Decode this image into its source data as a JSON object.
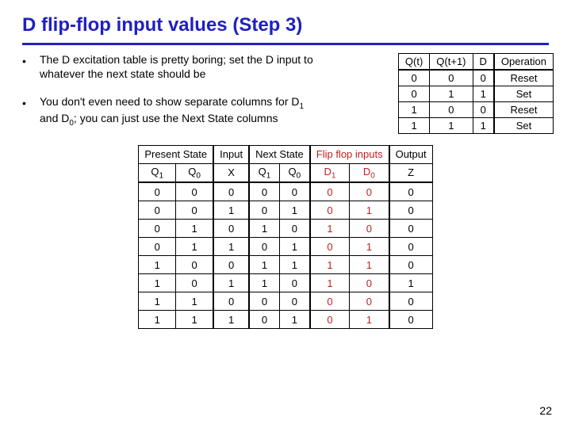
{
  "title": "D flip-flop input values (Step 3)",
  "bullets": [
    "The D excitation table is pretty boring; set the D input to whatever the next state should be",
    "You don't even need to show separate columns for D₁ and D₀; you can just use the Next State columns"
  ],
  "excitation_table": {
    "headers": [
      "Q(t)",
      "Q(t+1)",
      "D",
      "Operation"
    ],
    "rows": [
      [
        "0",
        "0",
        "0",
        "Reset"
      ],
      [
        "0",
        "1",
        "1",
        "Set"
      ],
      [
        "1",
        "0",
        "0",
        "Reset"
      ],
      [
        "1",
        "1",
        "1",
        "Set"
      ]
    ]
  },
  "main_table": {
    "group_headers": [
      {
        "label": "Present State",
        "span": 2
      },
      {
        "label": "Input",
        "span": 1
      },
      {
        "label": "Next State",
        "span": 2
      },
      {
        "label": "Flip flop inputs",
        "span": 2
      },
      {
        "label": "Output",
        "span": 1
      }
    ],
    "sub_headers": [
      "Q₁",
      "Q₀",
      "X",
      "Q₁",
      "Q₀",
      "D₁",
      "D₀",
      "Z"
    ],
    "rows": [
      [
        "0",
        "0",
        "0",
        "0",
        "0",
        "0",
        "0",
        "0"
      ],
      [
        "0",
        "0",
        "1",
        "0",
        "1",
        "0",
        "1",
        "0"
      ],
      [
        "0",
        "1",
        "0",
        "1",
        "0",
        "1",
        "0",
        "0"
      ],
      [
        "0",
        "1",
        "1",
        "0",
        "1",
        "0",
        "1",
        "0"
      ],
      [
        "1",
        "0",
        "0",
        "1",
        "1",
        "1",
        "1",
        "0"
      ],
      [
        "1",
        "0",
        "1",
        "1",
        "0",
        "1",
        "0",
        "1"
      ],
      [
        "1",
        "1",
        "0",
        "0",
        "0",
        "0",
        "0",
        "0"
      ],
      [
        "1",
        "1",
        "1",
        "0",
        "1",
        "0",
        "1",
        "0"
      ]
    ]
  },
  "page_number": "22"
}
